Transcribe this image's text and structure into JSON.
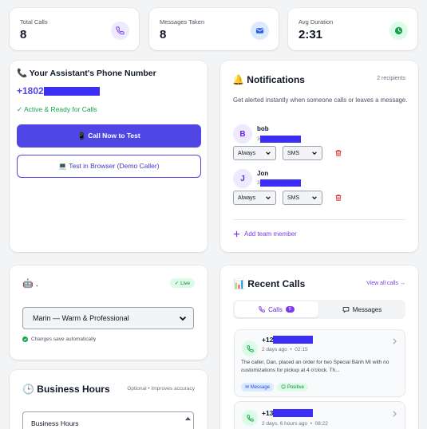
{
  "stats": [
    {
      "label": "Total Calls",
      "value": "8",
      "icon": "phone-icon",
      "icon_bg": "#ede9fe",
      "icon_color": "#7c3aed"
    },
    {
      "label": "Messages Taken",
      "value": "8",
      "icon": "mail-icon",
      "icon_bg": "#dbeafe",
      "icon_color": "#2563eb"
    },
    {
      "label": "Avg Duration",
      "value": "2:31",
      "icon": "clock-icon",
      "icon_bg": "#dcfce7",
      "icon_color": "#16a34a"
    }
  ],
  "phone_card": {
    "title": "📞 Your Assistant's Phone Number",
    "number_prefix": "+1802",
    "status": "✓ Active & Ready for Calls",
    "call_button": "📱 Call Now to Test",
    "browser_button": "💻 Test in Browser (Demo Caller)"
  },
  "notifications": {
    "title": "🔔 Notifications",
    "recipients": "2 recipients",
    "description": "Get alerted instantly when someone calls or leaves a message.",
    "people": [
      {
        "initial": "B",
        "name": "bob",
        "sub_prefix": "3",
        "when": "Always",
        "method": "SMS"
      },
      {
        "initial": "J",
        "name": "Jon",
        "sub_prefix": "3",
        "when": "Always",
        "method": "SMS"
      }
    ],
    "add_label": "Add team member"
  },
  "voice_card": {
    "robot": "🤖 .",
    "live": "✓ Live",
    "selected_voice": "Marin — Warm & Professional",
    "autosave": "Changes save automatically"
  },
  "recent_calls": {
    "title": "📊 Recent Calls",
    "view_all": "View all calls →",
    "tab_calls": "Calls",
    "tab_calls_count": "5",
    "tab_messages": "Messages",
    "items": [
      {
        "number_prefix": "+12",
        "meta": "2 days ago  •  02:15",
        "summary": "The caller, Dan, placed an order for two Special Bánh Mì with no customizations for pickup at 4 o'clock. Th...",
        "tag1": "✉ Message",
        "tag2": "😊 Positive"
      },
      {
        "number_prefix": "+13",
        "meta": "2 days, 6 hours ago  •  08:22"
      }
    ]
  },
  "business_hours": {
    "title": "🕒 Business Hours",
    "note": "Optional • Improves accuracy",
    "field_value": "Business Hours"
  },
  "colors": {
    "accent": "#4f46e5",
    "brand_purple": "#7c3aed",
    "success": "#16a34a",
    "danger": "#dc2626"
  }
}
